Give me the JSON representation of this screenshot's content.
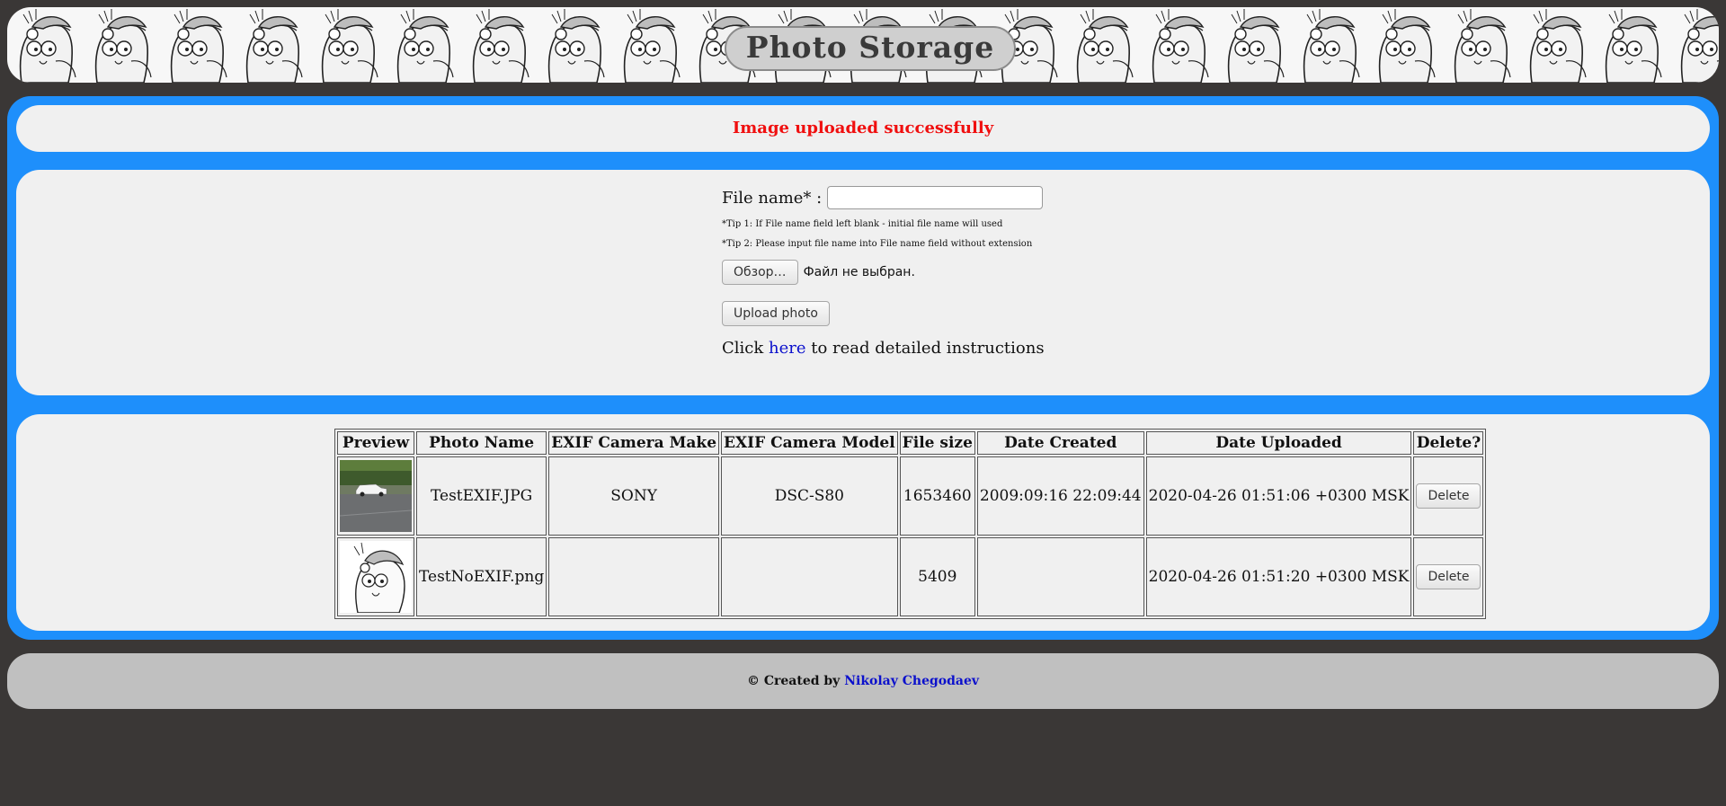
{
  "header": {
    "title": "Photo Storage"
  },
  "message": "Image uploaded successfully",
  "form": {
    "filename_label": "File name* :",
    "filename_value": "",
    "tip1": "*Tip 1: If File name field left blank - initial file name will used",
    "tip2": "*Tip 2: Please input file name into File name field without extension",
    "browse_label": "Обзор…",
    "file_status": "Файл не выбран.",
    "upload_label": "Upload photo",
    "instr_before": "Click ",
    "instr_link": "here",
    "instr_after": " to read detailed instructions"
  },
  "table": {
    "headers": [
      "Preview",
      "Photo Name",
      "EXIF Camera Make",
      "EXIF Camera Model",
      "File size",
      "Date Created",
      "Date Uploaded",
      "Delete?"
    ],
    "rows": [
      {
        "preview": "car-photo-thumbnail",
        "name": "TestEXIF.JPG",
        "make": "SONY",
        "model": "DSC-S80",
        "size": "1653460",
        "created": "2009:09:16 22:09:44",
        "uploaded": "2020-04-26 01:51:06 +0300 MSK",
        "delete_label": "Delete"
      },
      {
        "preview": "gopher-drawing-thumbnail",
        "name": "TestNoEXIF.png",
        "make": "",
        "model": "",
        "size": "5409",
        "created": "",
        "uploaded": "2020-04-26 01:51:20 +0300 MSK",
        "delete_label": "Delete"
      }
    ]
  },
  "footer": {
    "prefix": "© Created by ",
    "author": "Nikolay Chegodaev"
  },
  "colors": {
    "panel_blue": "#1e8ffb",
    "message_red": "#f00f0f",
    "link_blue": "#0b10cc",
    "background": "#3a3736"
  }
}
